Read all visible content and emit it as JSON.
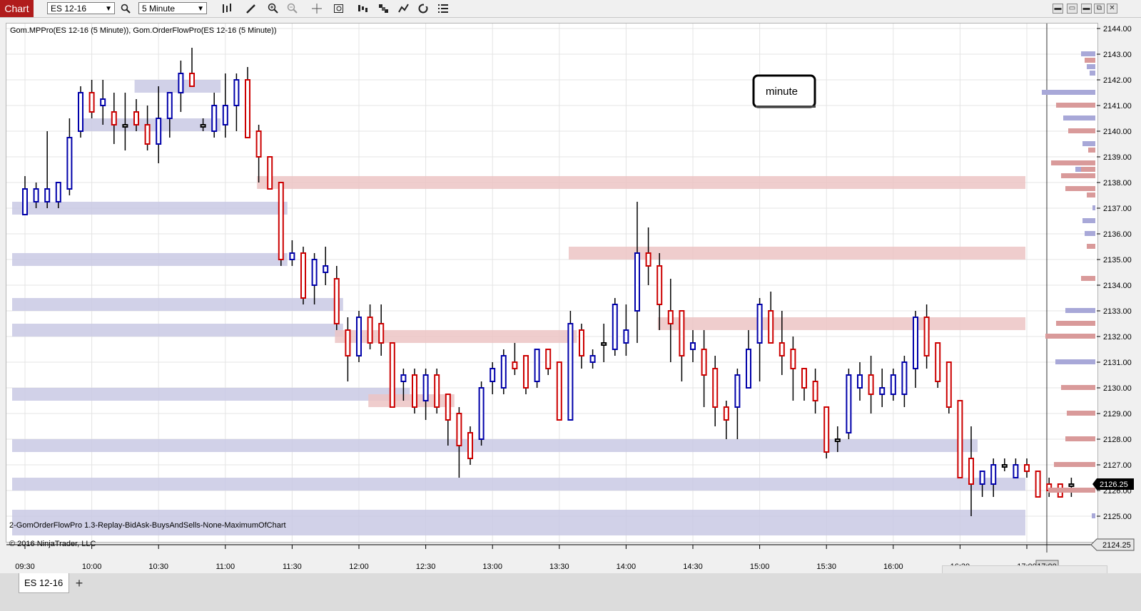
{
  "toolbar": {
    "chart_label": "Chart",
    "instrument": "ES 12-16",
    "interval": "5 Minute",
    "icons": [
      "search-icon",
      "bars-type-icon",
      "pencil-icon",
      "zoom-in-icon",
      "zoom-out-icon",
      "crosshair-icon",
      "data-box-icon",
      "properties-icon",
      "strategies-icon",
      "indicators-icon",
      "reload-icon",
      "list-icon"
    ],
    "window_buttons": [
      "minimize-icon",
      "restore-icon",
      "maximize-icon",
      "close-icon"
    ]
  },
  "indicator_label": "Gom.MPPro(ES 12-16 (5 Minute)), Gom.OrderFlowPro(ES 12-16 (5 Minute))",
  "bottom_label": "2-GomOrderFlowPro 1.3-Replay-BidAsk-BuysAndSells-None-MaximumOfChart",
  "copyright": "© 2016 NinjaTrader, LLC",
  "annotation": "minute",
  "last_price": "2126.25",
  "low_marker": "2124.25",
  "time_marker": "17:00",
  "tab_label": "ES 12-16",
  "tab_add": "+",
  "colors": {
    "up": "#0000aa",
    "down": "#cc0000",
    "doji": "#000000",
    "blue_zone": "#c9c9e4",
    "red_zone": "#ecc4c4",
    "price_tag": "#000000"
  },
  "chart_data": {
    "type": "candlestick",
    "instrument": "ES 12-16",
    "interval": "5 Minute",
    "ylim": [
      2124.25,
      2144.25
    ],
    "yticks": [
      "2144.00",
      "2143.00",
      "2142.00",
      "2141.00",
      "2140.00",
      "2139.00",
      "2138.00",
      "2137.00",
      "2136.00",
      "2135.00",
      "2134.00",
      "2133.00",
      "2132.00",
      "2131.00",
      "2130.00",
      "2129.00",
      "2128.00",
      "2127.00",
      "2126.00",
      "2125.00"
    ],
    "xticks": [
      "09:30",
      "10:00",
      "10:30",
      "11:00",
      "11:30",
      "12:00",
      "12:30",
      "13:00",
      "13:30",
      "14:00",
      "14:30",
      "15:00",
      "15:30",
      "16:00",
      "16:30",
      "17:00"
    ],
    "bars": [
      {
        "t": "09:30",
        "o": 2136.75,
        "h": 2138.25,
        "l": 2136.75,
        "c": 2137.75
      },
      {
        "t": "09:35",
        "o": 2137.25,
        "h": 2138.0,
        "l": 2137.0,
        "c": 2137.75
      },
      {
        "t": "09:40",
        "o": 2137.25,
        "h": 2140.0,
        "l": 2137.0,
        "c": 2137.75
      },
      {
        "t": "09:45",
        "o": 2137.25,
        "h": 2138.0,
        "l": 2137.0,
        "c": 2138.0
      },
      {
        "t": "09:50",
        "o": 2137.75,
        "h": 2140.5,
        "l": 2137.5,
        "c": 2139.75
      },
      {
        "t": "09:55",
        "o": 2140.0,
        "h": 2141.75,
        "l": 2139.75,
        "c": 2141.5
      },
      {
        "t": "10:00",
        "o": 2141.5,
        "h": 2142.0,
        "l": 2140.5,
        "c": 2140.75
      },
      {
        "t": "10:05",
        "o": 2141.0,
        "h": 2142.0,
        "l": 2140.25,
        "c": 2141.25
      },
      {
        "t": "10:10",
        "o": 2140.75,
        "h": 2141.5,
        "l": 2139.5,
        "c": 2140.25
      },
      {
        "t": "10:15",
        "o": 2140.25,
        "h": 2141.5,
        "l": 2139.25,
        "c": 2140.25
      },
      {
        "t": "10:20",
        "o": 2140.75,
        "h": 2141.25,
        "l": 2140.0,
        "c": 2140.25
      },
      {
        "t": "10:25",
        "o": 2140.25,
        "h": 2141.0,
        "l": 2139.25,
        "c": 2139.5
      },
      {
        "t": "10:30",
        "o": 2139.5,
        "h": 2141.75,
        "l": 2138.75,
        "c": 2140.5
      },
      {
        "t": "10:35",
        "o": 2140.5,
        "h": 2141.5,
        "l": 2139.75,
        "c": 2141.5
      },
      {
        "t": "10:40",
        "o": 2141.5,
        "h": 2142.75,
        "l": 2140.75,
        "c": 2142.25
      },
      {
        "t": "10:45",
        "o": 2142.25,
        "h": 2143.25,
        "l": 2141.75,
        "c": 2141.75
      },
      {
        "t": "10:50",
        "o": 2140.25,
        "h": 2140.5,
        "l": 2140.0,
        "c": 2140.25
      },
      {
        "t": "10:55",
        "o": 2140.0,
        "h": 2141.5,
        "l": 2139.75,
        "c": 2141.0
      },
      {
        "t": "11:00",
        "o": 2140.25,
        "h": 2142.25,
        "l": 2139.75,
        "c": 2141.0
      },
      {
        "t": "11:05",
        "o": 2141.0,
        "h": 2142.25,
        "l": 2140.0,
        "c": 2142.0
      },
      {
        "t": "11:10",
        "o": 2142.0,
        "h": 2142.5,
        "l": 2139.75,
        "c": 2139.75
      },
      {
        "t": "11:15",
        "o": 2140.0,
        "h": 2140.25,
        "l": 2138.0,
        "c": 2139.0
      },
      {
        "t": "11:20",
        "o": 2139.0,
        "h": 2139.0,
        "l": 2137.75,
        "c": 2137.75
      },
      {
        "t": "11:25",
        "o": 2138.0,
        "h": 2138.0,
        "l": 2134.75,
        "c": 2135.0
      },
      {
        "t": "11:30",
        "o": 2135.0,
        "h": 2135.75,
        "l": 2134.75,
        "c": 2135.25
      },
      {
        "t": "11:35",
        "o": 2135.25,
        "h": 2135.5,
        "l": 2133.25,
        "c": 2133.5
      },
      {
        "t": "11:40",
        "o": 2134.0,
        "h": 2135.25,
        "l": 2133.25,
        "c": 2135.0
      },
      {
        "t": "11:45",
        "o": 2134.5,
        "h": 2135.5,
        "l": 2134.0,
        "c": 2134.75
      },
      {
        "t": "11:50",
        "o": 2134.25,
        "h": 2134.75,
        "l": 2132.25,
        "c": 2132.5
      },
      {
        "t": "11:55",
        "o": 2132.25,
        "h": 2132.75,
        "l": 2130.25,
        "c": 2131.25
      },
      {
        "t": "12:00",
        "o": 2131.25,
        "h": 2133.0,
        "l": 2131.0,
        "c": 2132.75
      },
      {
        "t": "12:05",
        "o": 2132.75,
        "h": 2133.25,
        "l": 2131.5,
        "c": 2131.75
      },
      {
        "t": "12:10",
        "o": 2132.5,
        "h": 2133.25,
        "l": 2131.25,
        "c": 2131.75
      },
      {
        "t": "12:15",
        "o": 2131.75,
        "h": 2131.75,
        "l": 2129.25,
        "c": 2129.25
      },
      {
        "t": "12:20",
        "o": 2130.25,
        "h": 2130.75,
        "l": 2129.5,
        "c": 2130.5
      },
      {
        "t": "12:25",
        "o": 2130.5,
        "h": 2130.75,
        "l": 2129.0,
        "c": 2129.25
      },
      {
        "t": "12:30",
        "o": 2129.5,
        "h": 2130.75,
        "l": 2128.75,
        "c": 2130.5
      },
      {
        "t": "12:35",
        "o": 2130.5,
        "h": 2130.75,
        "l": 2129.0,
        "c": 2129.25
      },
      {
        "t": "12:40",
        "o": 2129.75,
        "h": 2129.75,
        "l": 2127.75,
        "c": 2128.75
      },
      {
        "t": "12:45",
        "o": 2129.0,
        "h": 2129.25,
        "l": 2126.5,
        "c": 2127.75
      },
      {
        "t": "12:50",
        "o": 2128.25,
        "h": 2128.5,
        "l": 2127.0,
        "c": 2127.25
      },
      {
        "t": "12:55",
        "o": 2128.0,
        "h": 2130.25,
        "l": 2127.75,
        "c": 2130.0
      },
      {
        "t": "13:00",
        "o": 2130.25,
        "h": 2131.0,
        "l": 2129.75,
        "c": 2130.75
      },
      {
        "t": "13:05",
        "o": 2130.0,
        "h": 2131.5,
        "l": 2129.75,
        "c": 2131.25
      },
      {
        "t": "13:10",
        "o": 2131.0,
        "h": 2131.75,
        "l": 2130.5,
        "c": 2130.75
      },
      {
        "t": "13:15",
        "o": 2131.25,
        "h": 2131.25,
        "l": 2129.75,
        "c": 2130.0
      },
      {
        "t": "13:20",
        "o": 2130.25,
        "h": 2131.5,
        "l": 2130.0,
        "c": 2131.5
      },
      {
        "t": "13:25",
        "o": 2131.5,
        "h": 2131.5,
        "l": 2130.5,
        "c": 2130.75
      },
      {
        "t": "13:30",
        "o": 2131.0,
        "h": 2131.0,
        "l": 2128.75,
        "c": 2128.75
      },
      {
        "t": "13:35",
        "o": 2128.75,
        "h": 2133.0,
        "l": 2128.75,
        "c": 2132.5
      },
      {
        "t": "13:40",
        "o": 2132.25,
        "h": 2132.5,
        "l": 2130.75,
        "c": 2131.25
      },
      {
        "t": "13:45",
        "o": 2131.0,
        "h": 2131.5,
        "l": 2130.75,
        "c": 2131.25
      },
      {
        "t": "13:50",
        "o": 2131.75,
        "h": 2132.5,
        "l": 2131.0,
        "c": 2131.75
      },
      {
        "t": "13:55",
        "o": 2131.5,
        "h": 2133.5,
        "l": 2131.25,
        "c": 2133.25
      },
      {
        "t": "14:00",
        "o": 2131.75,
        "h": 2133.25,
        "l": 2131.25,
        "c": 2132.25
      },
      {
        "t": "14:05",
        "o": 2133.0,
        "h": 2137.25,
        "l": 2131.75,
        "c": 2135.25
      },
      {
        "t": "14:10",
        "o": 2135.25,
        "h": 2136.25,
        "l": 2134.0,
        "c": 2134.75
      },
      {
        "t": "14:15",
        "o": 2134.75,
        "h": 2135.25,
        "l": 2132.25,
        "c": 2133.25
      },
      {
        "t": "14:20",
        "o": 2133.0,
        "h": 2134.25,
        "l": 2131.0,
        "c": 2132.5
      },
      {
        "t": "14:25",
        "o": 2133.0,
        "h": 2133.0,
        "l": 2130.25,
        "c": 2131.25
      },
      {
        "t": "14:30",
        "o": 2131.5,
        "h": 2132.25,
        "l": 2131.0,
        "c": 2131.75
      },
      {
        "t": "14:35",
        "o": 2131.5,
        "h": 2132.25,
        "l": 2129.25,
        "c": 2130.5
      },
      {
        "t": "14:40",
        "o": 2130.75,
        "h": 2131.25,
        "l": 2128.5,
        "c": 2129.25
      },
      {
        "t": "14:45",
        "o": 2129.25,
        "h": 2129.5,
        "l": 2128.0,
        "c": 2128.75
      },
      {
        "t": "14:50",
        "o": 2129.25,
        "h": 2130.75,
        "l": 2128.0,
        "c": 2130.5
      },
      {
        "t": "14:55",
        "o": 2130.0,
        "h": 2132.25,
        "l": 2130.0,
        "c": 2131.5
      },
      {
        "t": "15:00",
        "o": 2131.75,
        "h": 2133.5,
        "l": 2130.25,
        "c": 2133.25
      },
      {
        "t": "15:05",
        "o": 2133.0,
        "h": 2133.75,
        "l": 2131.75,
        "c": 2131.75
      },
      {
        "t": "15:10",
        "o": 2131.75,
        "h": 2133.0,
        "l": 2130.5,
        "c": 2131.25
      },
      {
        "t": "15:15",
        "o": 2131.5,
        "h": 2132.0,
        "l": 2129.5,
        "c": 2130.75
      },
      {
        "t": "15:20",
        "o": 2130.75,
        "h": 2130.75,
        "l": 2129.5,
        "c": 2130.0
      },
      {
        "t": "15:25",
        "o": 2130.25,
        "h": 2130.75,
        "l": 2129.0,
        "c": 2129.5
      },
      {
        "t": "15:30",
        "o": 2129.25,
        "h": 2129.25,
        "l": 2127.25,
        "c": 2127.5
      },
      {
        "t": "15:35",
        "o": 2128.0,
        "h": 2128.5,
        "l": 2127.5,
        "c": 2128.0
      },
      {
        "t": "15:40",
        "o": 2128.25,
        "h": 2130.75,
        "l": 2128.0,
        "c": 2130.5
      },
      {
        "t": "15:45",
        "o": 2130.0,
        "h": 2131.0,
        "l": 2129.5,
        "c": 2130.5
      },
      {
        "t": "15:50",
        "o": 2130.5,
        "h": 2131.25,
        "l": 2129.0,
        "c": 2129.75
      },
      {
        "t": "15:55",
        "o": 2129.75,
        "h": 2130.75,
        "l": 2129.25,
        "c": 2130.0
      },
      {
        "t": "16:00",
        "o": 2129.75,
        "h": 2130.75,
        "l": 2129.5,
        "c": 2130.5
      },
      {
        "t": "16:05",
        "o": 2129.75,
        "h": 2131.25,
        "l": 2129.25,
        "c": 2131.0
      },
      {
        "t": "16:10",
        "o": 2130.75,
        "h": 2133.0,
        "l": 2130.0,
        "c": 2132.75
      },
      {
        "t": "16:15",
        "o": 2132.75,
        "h": 2133.25,
        "l": 2130.75,
        "c": 2131.25
      },
      {
        "t": "16:20",
        "o": 2131.75,
        "h": 2131.75,
        "l": 2130.0,
        "c": 2130.25
      },
      {
        "t": "16:25",
        "o": 2131.0,
        "h": 2131.0,
        "l": 2129.0,
        "c": 2129.25
      },
      {
        "t": "16:30",
        "o": 2129.5,
        "h": 2129.5,
        "l": 2127.0,
        "c": 2126.5
      },
      {
        "t": "16:35",
        "o": 2127.25,
        "h": 2128.5,
        "l": 2125.0,
        "c": 2126.25
      },
      {
        "t": "16:40",
        "o": 2126.25,
        "h": 2126.75,
        "l": 2125.75,
        "c": 2126.75
      },
      {
        "t": "16:45",
        "o": 2126.25,
        "h": 2127.25,
        "l": 2125.75,
        "c": 2127.0
      },
      {
        "t": "16:50",
        "o": 2127.0,
        "h": 2127.25,
        "l": 2126.75,
        "c": 2127.0
      },
      {
        "t": "16:55",
        "o": 2126.5,
        "h": 2127.25,
        "l": 2126.5,
        "c": 2127.0
      },
      {
        "t": "17:00",
        "o": 2127.0,
        "h": 2127.25,
        "l": 2126.5,
        "c": 2126.75
      },
      {
        "t": "17:05",
        "o": 2126.75,
        "h": 2126.75,
        "l": 2125.75,
        "c": 2125.75
      },
      {
        "t": "17:10",
        "o": 2126.25,
        "h": 2126.5,
        "l": 2125.75,
        "c": 2126.0
      },
      {
        "t": "17:15",
        "o": 2126.25,
        "h": 2126.25,
        "l": 2125.75,
        "c": 2125.75
      },
      {
        "t": "17:20",
        "o": 2126.25,
        "h": 2126.5,
        "l": 2125.75,
        "c": 2126.25
      }
    ],
    "zones": [
      {
        "from": "09:30",
        "to": "11:25",
        "price": 2137.0,
        "kind": "buy"
      },
      {
        "from": "09:30",
        "to": "11:25",
        "price": 2135.0,
        "kind": "buy"
      },
      {
        "from": "09:30",
        "to": "11:50",
        "price": 2133.25,
        "kind": "buy"
      },
      {
        "from": "09:30",
        "to": "11:50",
        "price": 2132.25,
        "kind": "buy"
      },
      {
        "from": "09:30",
        "to": "12:20",
        "price": 2129.75,
        "kind": "buy"
      },
      {
        "from": "09:30",
        "to": "16:35",
        "price": 2127.75,
        "kind": "buy"
      },
      {
        "from": "09:30",
        "to": "17:20",
        "price": 2126.25,
        "kind": "buy"
      },
      {
        "from": "09:30",
        "to": "17:20",
        "price": 2125.0,
        "kind": "buy"
      },
      {
        "from": "09:30",
        "to": "17:20",
        "price": 2124.5,
        "kind": "buy"
      },
      {
        "from": "10:00",
        "to": "10:55",
        "price": 2140.25,
        "kind": "buy"
      },
      {
        "from": "10:25",
        "to": "10:55",
        "price": 2141.75,
        "kind": "buy"
      },
      {
        "from": "11:20",
        "to": "17:20",
        "price": 2138.0,
        "kind": "sell"
      },
      {
        "from": "13:40",
        "to": "17:20",
        "price": 2135.25,
        "kind": "sell"
      },
      {
        "from": "14:20",
        "to": "17:20",
        "price": 2132.5,
        "kind": "sell"
      },
      {
        "from": "11:55",
        "to": "13:35",
        "price": 2132.0,
        "kind": "sell"
      },
      {
        "from": "12:10",
        "to": "12:40",
        "price": 2129.5,
        "kind": "sell"
      }
    ],
    "volume_profile": [
      {
        "price": 2143.0,
        "buy": 20,
        "sell": 0
      },
      {
        "price": 2142.75,
        "buy": 0,
        "sell": 15
      },
      {
        "price": 2142.5,
        "buy": 12,
        "sell": 0
      },
      {
        "price": 2142.25,
        "buy": 8,
        "sell": 0
      },
      {
        "price": 2141.5,
        "buy": 75,
        "sell": 0
      },
      {
        "price": 2141.0,
        "buy": 0,
        "sell": 55
      },
      {
        "price": 2140.5,
        "buy": 45,
        "sell": 0
      },
      {
        "price": 2140.0,
        "buy": 0,
        "sell": 38
      },
      {
        "price": 2139.5,
        "buy": 18,
        "sell": 0
      },
      {
        "price": 2139.25,
        "buy": 0,
        "sell": 10
      },
      {
        "price": 2138.75,
        "buy": 0,
        "sell": 62
      },
      {
        "price": 2138.5,
        "buy": 28,
        "sell": 20
      },
      {
        "price": 2138.25,
        "buy": 0,
        "sell": 48
      },
      {
        "price": 2137.75,
        "buy": 0,
        "sell": 42
      },
      {
        "price": 2137.5,
        "buy": 0,
        "sell": 12
      },
      {
        "price": 2137.0,
        "buy": 4,
        "sell": 0
      },
      {
        "price": 2136.5,
        "buy": 18,
        "sell": 0
      },
      {
        "price": 2136.0,
        "buy": 15,
        "sell": 0
      },
      {
        "price": 2135.5,
        "buy": 0,
        "sell": 12
      },
      {
        "price": 2134.25,
        "buy": 0,
        "sell": 20
      },
      {
        "price": 2133.0,
        "buy": 42,
        "sell": 0
      },
      {
        "price": 2132.5,
        "buy": 0,
        "sell": 55
      },
      {
        "price": 2132.0,
        "buy": 0,
        "sell": 70
      },
      {
        "price": 2131.0,
        "buy": 56,
        "sell": 0
      },
      {
        "price": 2130.0,
        "buy": 0,
        "sell": 48
      },
      {
        "price": 2129.0,
        "buy": 0,
        "sell": 40
      },
      {
        "price": 2128.0,
        "buy": 0,
        "sell": 42
      },
      {
        "price": 2127.0,
        "buy": 0,
        "sell": 58
      },
      {
        "price": 2126.0,
        "buy": 0,
        "sell": 66
      },
      {
        "price": 2125.0,
        "buy": 5,
        "sell": 0
      }
    ]
  }
}
